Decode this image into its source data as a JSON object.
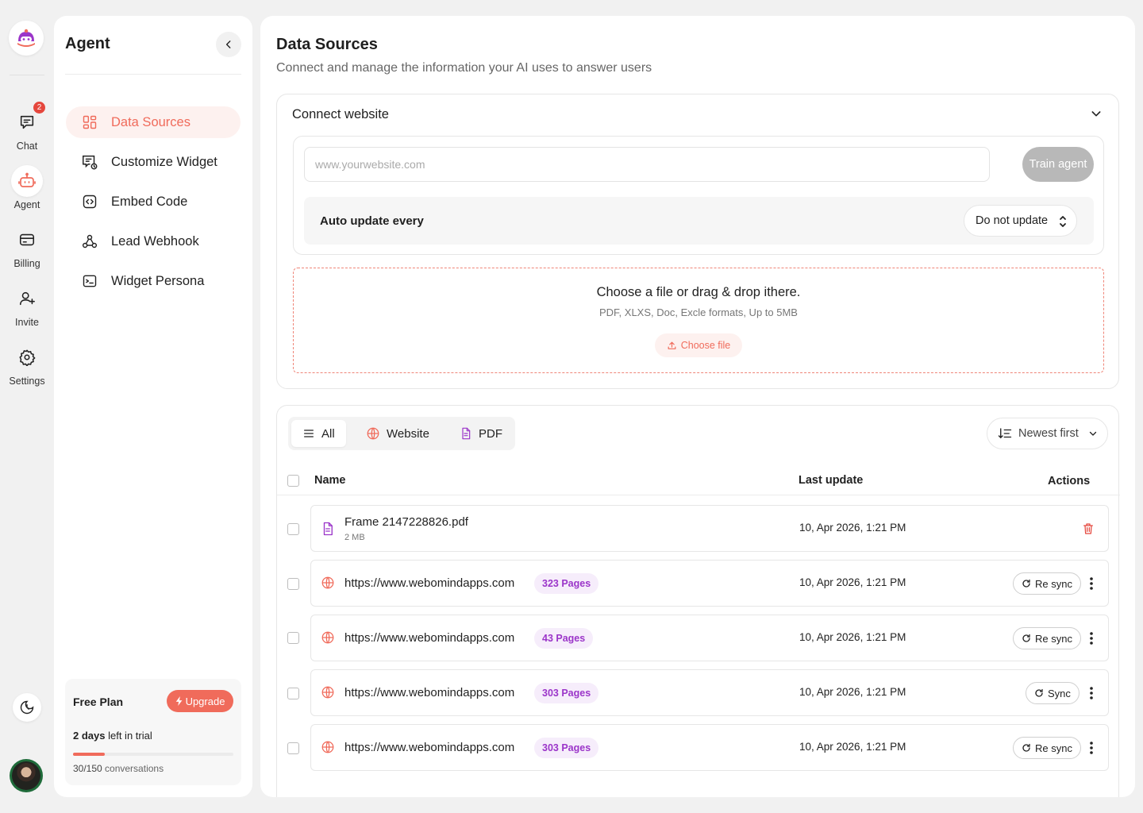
{
  "rail": {
    "items": [
      {
        "label": "Chat",
        "icon": "chat-icon",
        "badge": "2"
      },
      {
        "label": "Agent",
        "icon": "robot-icon"
      },
      {
        "label": "Billing",
        "icon": "card-icon"
      },
      {
        "label": "Invite",
        "icon": "user-plus-icon"
      },
      {
        "label": "Settings",
        "icon": "gear-icon"
      }
    ]
  },
  "sidebar": {
    "title": "Agent",
    "items": [
      {
        "label": "Data Sources",
        "icon": "grid-icon",
        "active": true
      },
      {
        "label": "Customize Widget",
        "icon": "customize-icon"
      },
      {
        "label": "Embed Code",
        "icon": "code-icon"
      },
      {
        "label": "Lead Webhook",
        "icon": "webhook-icon"
      },
      {
        "label": "Widget Persona",
        "icon": "terminal-icon"
      }
    ],
    "plan": {
      "title": "Free Plan",
      "upgrade_label": "Upgrade",
      "trial_days": "2 days",
      "trial_suffix": " left in trial",
      "usage_count": "30/150",
      "usage_suffix": " conversations",
      "usage_fraction": 0.2
    }
  },
  "main": {
    "title": "Data Sources",
    "subtitle": "Connect and manage the information your AI uses to answer users",
    "connect": {
      "title": "Connect website",
      "url_placeholder": "www.yourwebsite.com",
      "train_label": "Train agent",
      "auto_update_label": "Auto update every",
      "auto_update_value": "Do not update"
    },
    "upload": {
      "title": "Choose a file or drag & drop ithere.",
      "subtitle": "PDF, XLXS, Doc, Excle formats, Up to 5MB",
      "button_label": "Choose file"
    },
    "filters": {
      "tabs": [
        {
          "label": "All",
          "active": true
        },
        {
          "label": "Website"
        },
        {
          "label": "PDF"
        }
      ],
      "sort_label": "Newest first"
    },
    "table": {
      "columns": {
        "name": "Name",
        "last_update": "Last update",
        "actions": "Actions"
      },
      "rows": [
        {
          "type": "pdf",
          "name": "Frame 2147228826.pdf",
          "size": "2 MB",
          "date": "10, Apr 2026, 1:21 PM",
          "action": "delete"
        },
        {
          "type": "website",
          "name": "https://www.webomindapps.com",
          "pages": "323 Pages",
          "date": "10, Apr 2026, 1:21 PM",
          "action": "Re sync"
        },
        {
          "type": "website",
          "name": "https://www.webomindapps.com",
          "pages": "43 Pages",
          "date": "10, Apr 2026, 1:21 PM",
          "action": "Re sync"
        },
        {
          "type": "website",
          "name": "https://www.webomindapps.com",
          "pages": "303 Pages",
          "date": "10, Apr 2026, 1:21 PM",
          "action": "Sync"
        },
        {
          "type": "website",
          "name": "https://www.webomindapps.com",
          "pages": "303 Pages",
          "date": "10, Apr 2026, 1:21 PM",
          "action": "Re sync"
        }
      ]
    }
  },
  "colors": {
    "accent": "#f06b5b",
    "badge": "#e5473d",
    "pages_bg": "#f6edfb",
    "pages_text": "#9b35c9",
    "delete": "#e5473d"
  }
}
